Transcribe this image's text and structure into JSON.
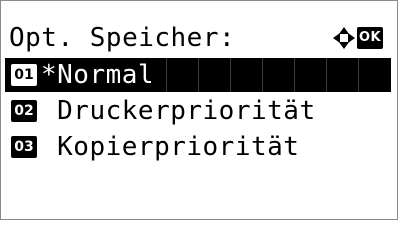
{
  "screen": {
    "title": "Opt. Speicher:",
    "nav_icon": "four-way-arrow-icon",
    "ok_label": "OK"
  },
  "menu": {
    "items": [
      {
        "number": "01",
        "label": "*Normal",
        "selected": true
      },
      {
        "number": "02",
        "label": " Druckerpriorität",
        "selected": false
      },
      {
        "number": "03",
        "label": " Kopierpriorität",
        "selected": false
      }
    ]
  },
  "colors": {
    "foreground": "#000000",
    "background": "#ffffff",
    "border": "#8a8a8a"
  }
}
